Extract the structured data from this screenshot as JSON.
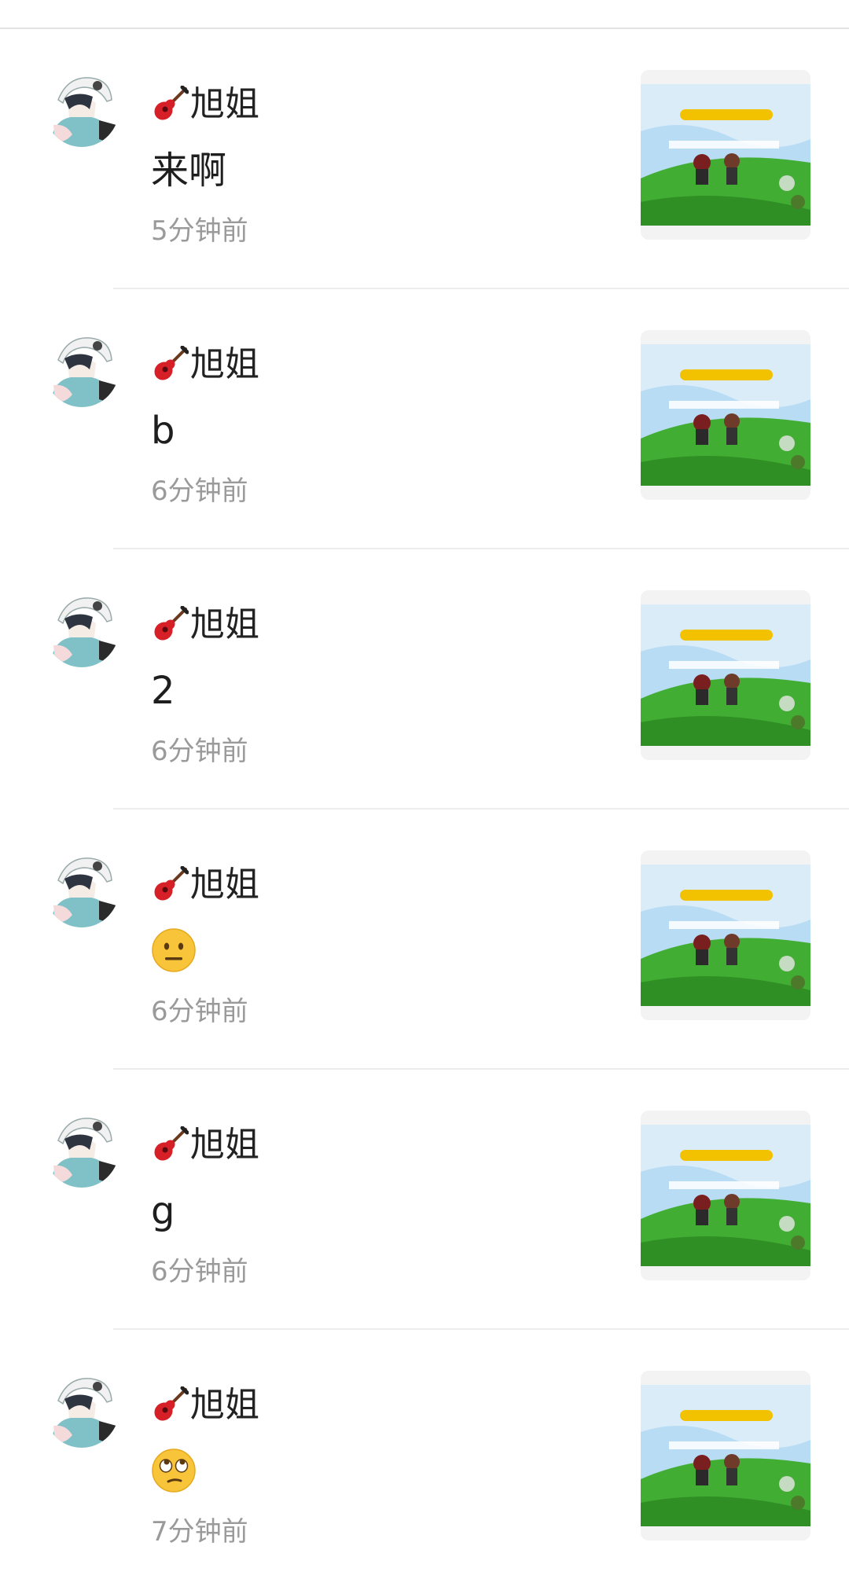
{
  "comments": [
    {
      "author": "旭姐",
      "message": "来啊",
      "message_type": "text",
      "time": "5分钟前",
      "avatar_icon": "anime-avatar-icon",
      "name_icon": "guitar-icon",
      "thumbnail": "game-screenshot"
    },
    {
      "author": "旭姐",
      "message": "b",
      "message_type": "text",
      "time": "6分钟前",
      "avatar_icon": "anime-avatar-icon",
      "name_icon": "guitar-icon",
      "thumbnail": "game-screenshot"
    },
    {
      "author": "旭姐",
      "message": "2",
      "message_type": "text",
      "time": "6分钟前",
      "avatar_icon": "anime-avatar-icon",
      "name_icon": "guitar-icon",
      "thumbnail": "game-screenshot"
    },
    {
      "author": "旭姐",
      "message": "neutral-face-emoji",
      "message_type": "emoji",
      "time": "6分钟前",
      "avatar_icon": "anime-avatar-icon",
      "name_icon": "guitar-icon",
      "thumbnail": "game-screenshot"
    },
    {
      "author": "旭姐",
      "message": "g",
      "message_type": "text",
      "time": "6分钟前",
      "avatar_icon": "anime-avatar-icon",
      "name_icon": "guitar-icon",
      "thumbnail": "game-screenshot"
    },
    {
      "author": "旭姐",
      "message": "eye-roll-emoji",
      "message_type": "emoji",
      "time": "7分钟前",
      "avatar_icon": "anime-avatar-icon",
      "name_icon": "guitar-icon",
      "thumbnail": "game-screenshot"
    }
  ],
  "colors": {
    "divider": "#ececec",
    "time_text": "#9a9a9a",
    "name_text": "#222222",
    "emoji_yellow": "#f8c53a",
    "guitar_red": "#d61f26",
    "sky": "#9fd0f2",
    "grass": "#3fae32",
    "banner": "#f2c200"
  }
}
